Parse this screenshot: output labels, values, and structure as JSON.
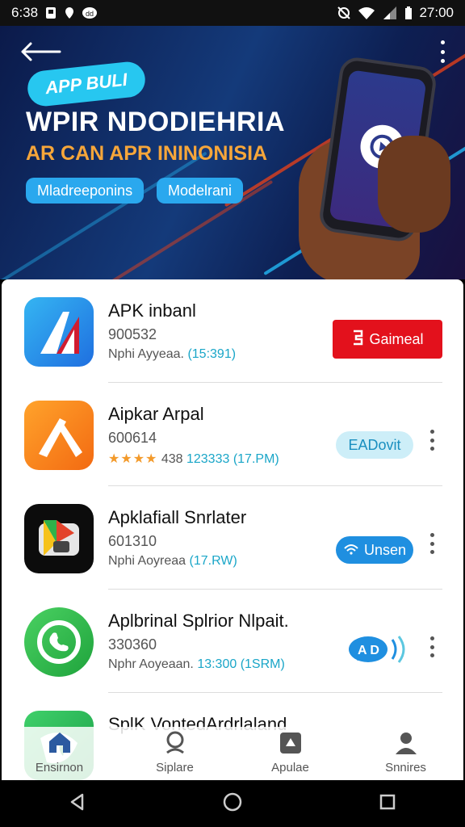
{
  "status_bar": {
    "time_left": "6:38",
    "time_right": "27:00"
  },
  "banner": {
    "badge": "APP BULI",
    "title": "WPIR NDODIEHRIA",
    "subtitle": "AR CAN APR ININONISIA",
    "pill_1": "Mladreeponins",
    "pill_2": "Modelrani"
  },
  "apps": [
    {
      "name": "APK inbanl",
      "number": "900532",
      "meta": "Nphi Ayyeaa.",
      "meta_accent": "(15:391)",
      "action": "Gaimeal",
      "icon": "app-a-icon"
    },
    {
      "name": "Aipkar Arpal",
      "number": "600614",
      "stars": "★★★★",
      "meta": "438",
      "meta_accent": "123333 (17.PM)",
      "action": "EADovit",
      "icon": "app-wrench-icon"
    },
    {
      "name": "Apklafiall Snrlater",
      "number": "601310",
      "meta": "Nphi Aoyreaa",
      "meta_accent": "(17.RW)",
      "action": "Unsen",
      "icon": "app-play-icon"
    },
    {
      "name": "Aplbrinal Splrior Nlpait.",
      "number": "330360",
      "meta": "Nphr Aoyeaan.",
      "meta_accent": "13:300 (1SRM)",
      "action": "A D",
      "icon": "app-phone-icon"
    },
    {
      "name": "SplK VontedArdrlaland",
      "number": "",
      "meta": "",
      "meta_accent": "",
      "action": "",
      "icon": "app-leaf-icon"
    }
  ],
  "tabs": [
    {
      "label": "Ensirnon",
      "icon": "home-icon"
    },
    {
      "label": "Siplare",
      "icon": "search-icon"
    },
    {
      "label": "Apulae",
      "icon": "apps-icon"
    },
    {
      "label": "Snnires",
      "icon": "profile-icon"
    }
  ],
  "colors": {
    "accent_red": "#e3111c",
    "accent_cyan": "#27c7f0",
    "accent_blue": "#1f8fe0",
    "accent_orange": "#f6a63a"
  }
}
